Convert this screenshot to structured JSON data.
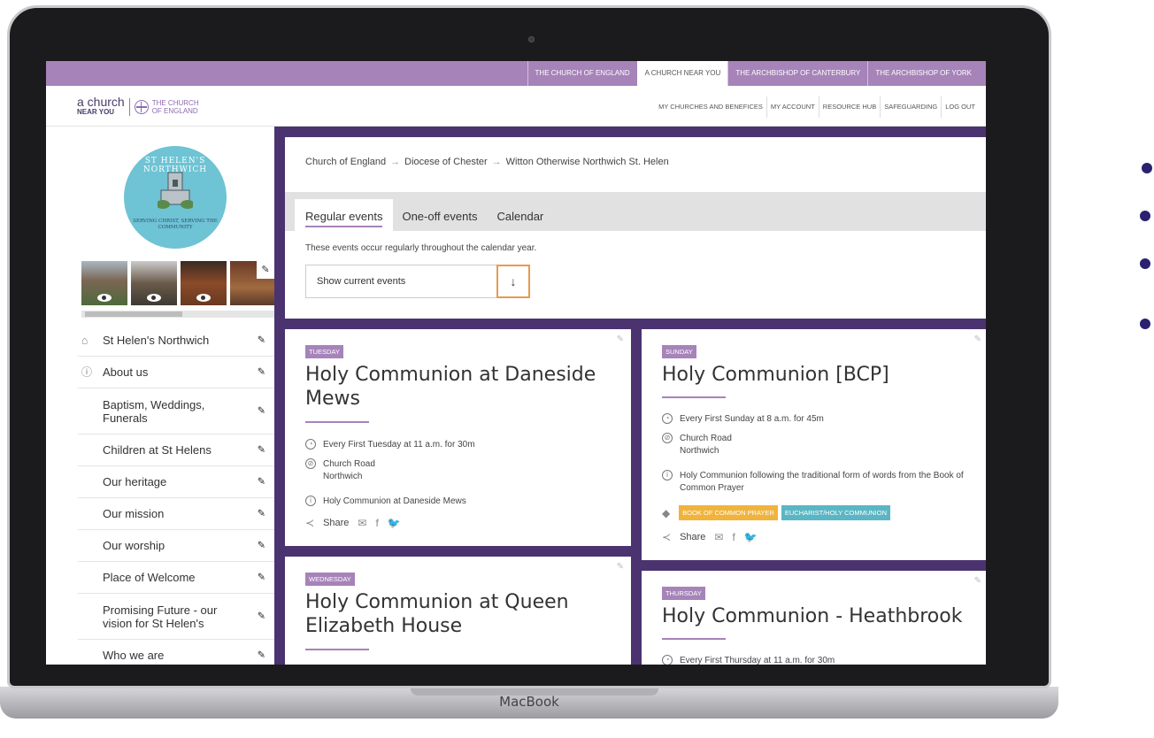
{
  "device": {
    "label": "MacBook"
  },
  "topnav": {
    "items": [
      {
        "label": "THE CHURCH OF ENGLAND",
        "active": false
      },
      {
        "label": "A CHURCH NEAR YOU",
        "active": true
      },
      {
        "label": "THE ARCHBISHOP OF CANTERBURY",
        "active": false
      },
      {
        "label": "THE ARCHBISHOP OF YORK",
        "active": false
      }
    ]
  },
  "header": {
    "logo_a": "a church",
    "logo_near": "NEAR YOU",
    "logo_coe_1": "THE CHURCH",
    "logo_coe_2": "OF ENGLAND",
    "usernav": [
      "MY CHURCHES AND BENEFICES",
      "MY ACCOUNT",
      "RESOURCE HUB",
      "SAFEGUARDING",
      "LOG OUT"
    ]
  },
  "sidebar": {
    "badge_top": "ST HELEN'S NORTHWICH",
    "badge_motto": "SERVING CHRIST, SERVING THE COMMUNITY",
    "items": [
      {
        "label": "St Helen's Northwich",
        "icon": "home-icon"
      },
      {
        "label": "About us",
        "icon": "info-icon"
      },
      {
        "label": "Baptism, Weddings, Funerals"
      },
      {
        "label": "Children at St Helens"
      },
      {
        "label": "Our heritage"
      },
      {
        "label": "Our mission"
      },
      {
        "label": "Our worship"
      },
      {
        "label": "Place of Welcome"
      },
      {
        "label": "Promising Future - our vision for St Helen's"
      },
      {
        "label": "Who we are"
      }
    ]
  },
  "panel": {
    "breadcrumb": [
      "Church of England",
      "Diocese of Chester",
      "Witton Otherwise Northwich St. Helen"
    ],
    "tabs": [
      {
        "label": "Regular events",
        "active": true
      },
      {
        "label": "One-off events",
        "active": false
      },
      {
        "label": "Calendar",
        "active": false
      }
    ],
    "note": "These events occur regularly throughout the calendar year.",
    "select_value": "Show current events"
  },
  "events": [
    {
      "day": "TUESDAY",
      "title": "Holy Communion at Daneside Mews",
      "time": "Every First Tuesday at 11 a.m. for 30m",
      "location_1": "Church Road",
      "location_2": "Northwich",
      "info": "Holy Communion at Daneside Mews",
      "share": "Share"
    },
    {
      "day": "SUNDAY",
      "title": "Holy Communion [BCP]",
      "time": "Every First Sunday at 8 a.m. for 45m",
      "location_1": "Church Road",
      "location_2": "Northwich",
      "info": "Holy Communion following the traditional form of words from the Book of Common Prayer",
      "tags": [
        {
          "label": "BOOK OF COMMON PRAYER",
          "color": "#f0b33c"
        },
        {
          "label": "EUCHARIST/HOLY COMMUNION",
          "color": "#5ab6c4"
        }
      ],
      "share": "Share"
    },
    {
      "day": "WEDNESDAY",
      "title": "Holy Communion at Queen Elizabeth House"
    },
    {
      "day": "THURSDAY",
      "title": "Holy Communion - Heathbrook",
      "time": "Every First Thursday at 11 a.m. for 30m"
    }
  ],
  "colors": {
    "purple_bar": "#a683b9",
    "main_bg": "#4b3370",
    "accent": "#a683b9",
    "select_btn_border": "#e69a4f"
  }
}
